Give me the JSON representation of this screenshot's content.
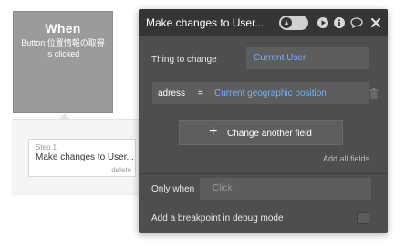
{
  "workflow": {
    "event_title": "When",
    "event_subtitle": "Button 位置情報の取得 is clicked",
    "step": {
      "number": "Step 1",
      "title": "Make changes to User...",
      "delete_label": "delete"
    }
  },
  "editor": {
    "title": "Make changes to User...",
    "header_icons": [
      "toggle-switch",
      "play-icon",
      "info-icon",
      "comment-icon",
      "close-icon"
    ],
    "thing_to_change_label": "Thing to change",
    "thing_to_change_value": "Current User",
    "field": {
      "name": "adress",
      "operator": "=",
      "value": "Current geographic position"
    },
    "change_another_field_label": "Change another field",
    "add_all_fields_label": "Add all fields",
    "only_when_label": "Only when",
    "only_when_placeholder": "Click",
    "breakpoint_label": "Add a breakpoint in debug mode",
    "breakpoint_checked": false
  },
  "colors": {
    "panel_bg": "#4e4e4e",
    "header_bg": "#353535",
    "dynamic_value": "#6eb0ff",
    "event_card": "#9b9b9b"
  }
}
